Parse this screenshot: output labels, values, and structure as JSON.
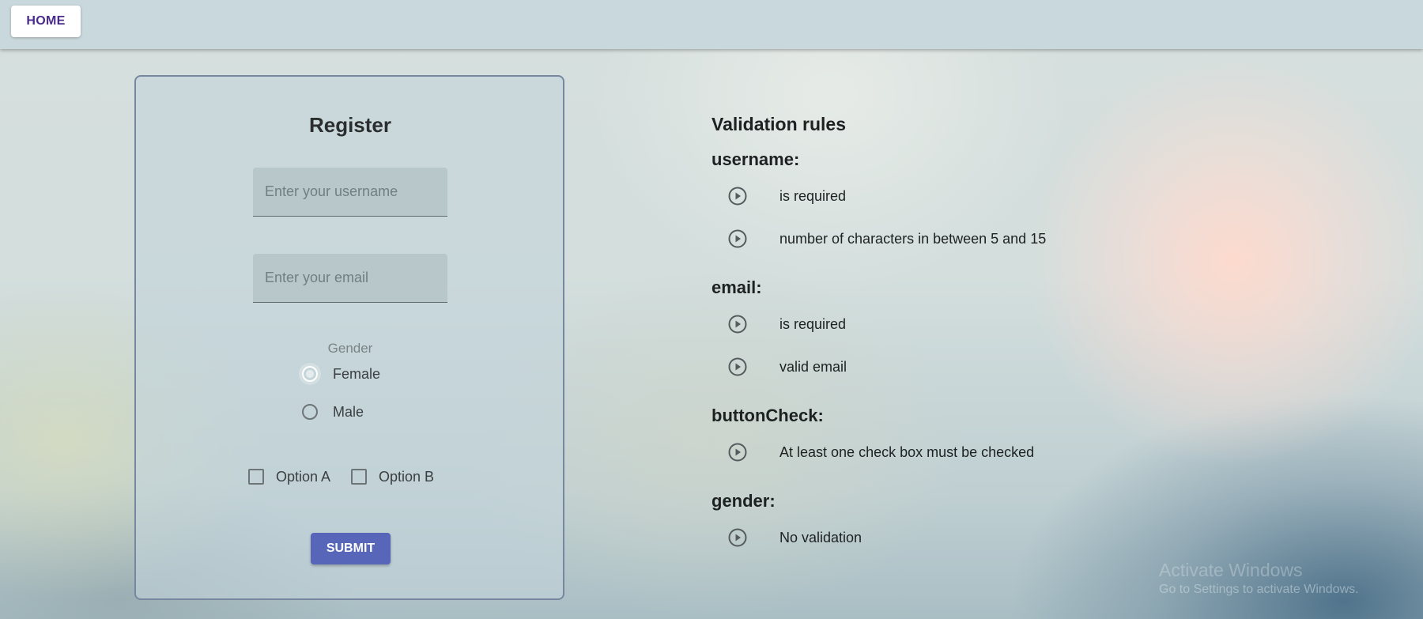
{
  "nav": {
    "home_label": "HOME"
  },
  "register": {
    "title": "Register",
    "username_placeholder": "Enter your username",
    "email_placeholder": "Enter your email",
    "gender_label": "Gender",
    "gender_options": [
      {
        "label": "Female",
        "selected": true
      },
      {
        "label": "Male",
        "selected": false
      }
    ],
    "checkbox_options": [
      {
        "label": "Option A",
        "checked": false
      },
      {
        "label": "Option B",
        "checked": false
      }
    ],
    "submit_label": "SUBMIT"
  },
  "rules": {
    "title": "Validation rules",
    "groups": [
      {
        "heading": "username:",
        "items": [
          "is required",
          "number of characters in between 5 and 15"
        ]
      },
      {
        "heading": "email:",
        "items": [
          "is required",
          "valid email"
        ]
      },
      {
        "heading": "buttonCheck:",
        "items": [
          "At least one check box must be checked"
        ]
      },
      {
        "heading": "gender:",
        "items": [
          "No validation"
        ]
      }
    ],
    "item_icon": "play-circle-icon"
  },
  "watermark": {
    "line1": "Activate Windows",
    "line2": "Go to Settings to activate Windows."
  },
  "colors": {
    "home_text": "#4a2a8c",
    "submit_bg": "#5766b9",
    "card_border": "#7787a0"
  }
}
